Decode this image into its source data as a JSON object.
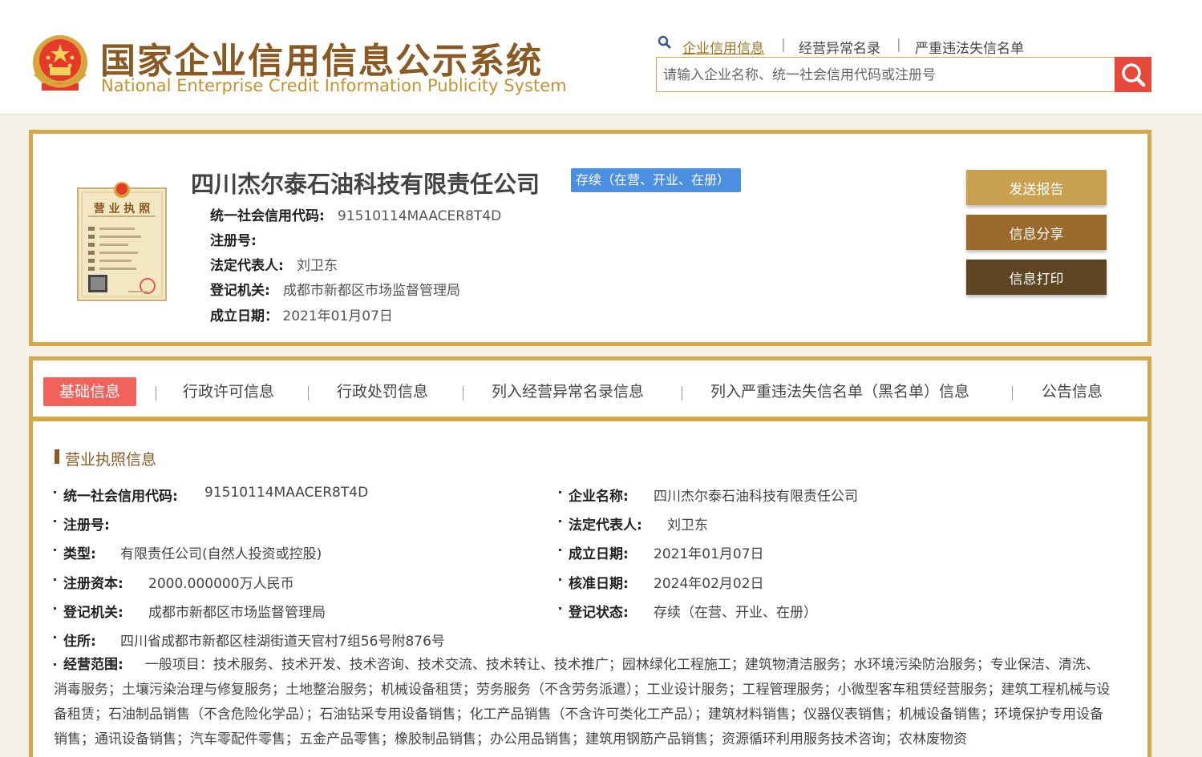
{
  "header": {
    "title_cn": "国家企业信用信息公示系统",
    "title_en": "National Enterprise Credit Information Publicity System",
    "nav": {
      "credit_info": "企业信用信息",
      "abnormal_list": "经营异常名录",
      "serious_violation": "严重违法失信名单"
    },
    "search": {
      "placeholder": "请输入企业名称、统一社会信用代码或注册号"
    }
  },
  "company": {
    "name": "四川杰尔泰石油科技有限责任公司",
    "status_badge": "存续（在营、开业、在册）",
    "summary": [
      {
        "label": "统一社会信用代码:",
        "value": "91510114MAACER8T4D"
      },
      {
        "label": "注册号:",
        "value": ""
      },
      {
        "label": "法定代表人:",
        "value": "刘卫东"
      },
      {
        "label": "登记机关:",
        "value": "成都市新都区市场监督管理局"
      },
      {
        "label": "成立日期：",
        "value": "2021年01月07日"
      }
    ],
    "license_title": "营 业 执 照"
  },
  "actions": {
    "send_report": "发送报告",
    "share": "信息分享",
    "print": "信息打印"
  },
  "colors": {
    "gold": "#d4a84b",
    "brown": "#8a5a22",
    "badge_blue": "#4a8fe0",
    "tab_active": "#f0625a",
    "search_red": "#e8483a",
    "btn1": "#c9a04f",
    "btn2": "#9a6a2a",
    "btn3": "#5e4522"
  },
  "tabs": [
    {
      "label": "基础信息",
      "active": true
    },
    {
      "label": "行政许可信息"
    },
    {
      "label": "行政处罚信息"
    },
    {
      "label": "列入经营异常名录信息"
    },
    {
      "label": "列入严重违法失信名单（黑名单）信息"
    },
    {
      "label": "公告信息"
    }
  ],
  "license_section": {
    "title": "营业执照信息",
    "left": [
      {
        "label": "统一社会信用代码:",
        "value": "91510114MAACER8T4D"
      },
      {
        "label": "注册号:",
        "value": ""
      },
      {
        "label": "类型:",
        "value": "有限责任公司(自然人投资或控股)"
      },
      {
        "label": "注册资本:",
        "value": "2000.000000万人民币"
      },
      {
        "label": "登记机关:",
        "value": "成都市新都区市场监督管理局"
      },
      {
        "label": "住所:",
        "value": "四川省成都市新都区桂湖街道天官村7组56号附876号"
      }
    ],
    "right": [
      {
        "label": "企业名称:",
        "value": "四川杰尔泰石油科技有限责任公司"
      },
      {
        "label": "法定代表人:",
        "value": "刘卫东"
      },
      {
        "label": "成立日期:",
        "value": "2021年01月07日"
      },
      {
        "label": "核准日期:",
        "value": "2024年02月02日"
      },
      {
        "label": "登记状态:",
        "value": "存续（在营、开业、在册）"
      }
    ],
    "scope": {
      "label": "经营范围:",
      "value": "一般项目：技术服务、技术开发、技术咨询、技术交流、技术转让、技术推广；园林绿化工程施工；建筑物清洁服务；水环境污染防治服务；专业保洁、清洗、消毒服务；土壤污染治理与修复服务；土地整治服务；机械设备租赁；劳务服务（不含劳务派遣）；工业设计服务；工程管理服务；小微型客车租赁经营服务；建筑工程机械与设备租赁；石油制品销售（不含危险化学品）；石油钻采专用设备销售；化工产品销售（不含许可类化工产品）；建筑材料销售；仪器仪表销售；机械设备销售；环境保护专用设备销售；通讯设备销售；汽车零配件零售；五金产品零售；橡胶制品销售；办公用品销售；建筑用钢筋产品销售；资源循环利用服务技术咨询；农林废物资"
    }
  }
}
